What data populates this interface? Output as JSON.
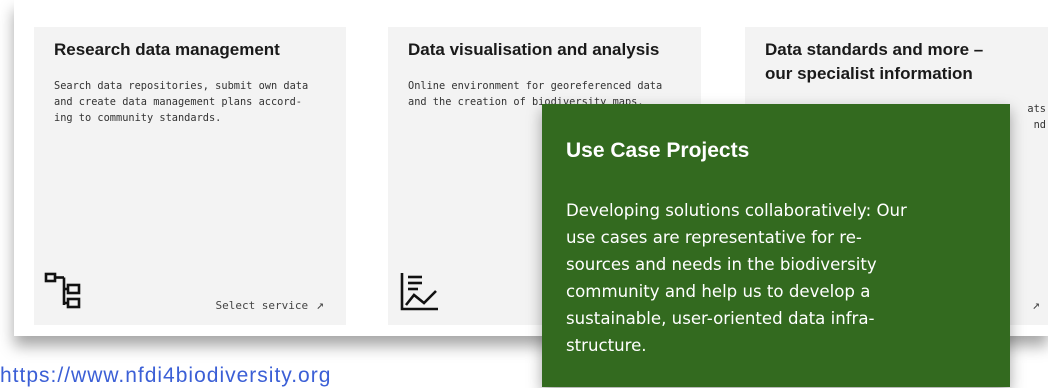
{
  "cards": [
    {
      "title": "Research data management",
      "description_lines": [
        "Search data repositories, submit own data",
        "and create data management plans accord-",
        "ing to community standards."
      ],
      "icon": "hierarchy-icon",
      "link_label": "Select service",
      "link_icon": "arrow-up-right-icon"
    },
    {
      "title": "Data visualisation and analysis",
      "description_lines": [
        "Online environment for georeferenced data",
        "and the creation of biodiversity maps."
      ],
      "icon": "line-chart-icon"
    },
    {
      "title_lines": [
        "Data standards and more –",
        "our specialist information"
      ],
      "description_fragments": [
        "ats",
        "nd"
      ],
      "link_icon": "arrow-up-right-icon"
    }
  ],
  "popup": {
    "title": "Use Case Projects",
    "body_lines": [
      "Developing solutions collaboratively: Our",
      "use cases are representative for re-",
      "sources and needs in the biodiversity",
      "community and help us to develop a",
      "sustainable, user-oriented data infra-",
      "structure."
    ],
    "background": "#336a1f"
  },
  "url_text": "https://www.nfdi4biodiversity.org",
  "colors": {
    "card_bg": "#f3f3f3",
    "popup_bg": "#336a1f",
    "link": "#3b5fd6"
  }
}
